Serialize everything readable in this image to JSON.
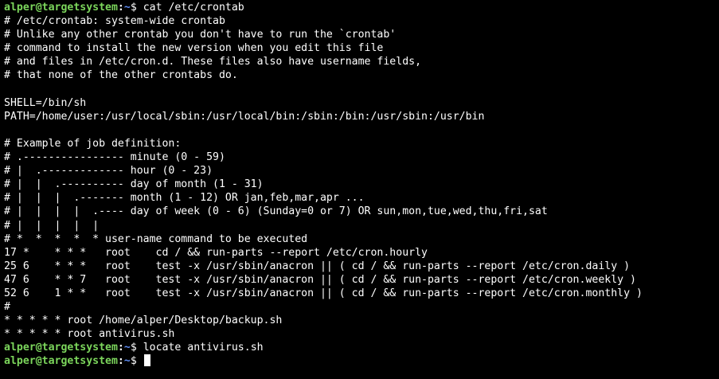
{
  "colors": {
    "background": "#000000",
    "text": "#ffffff",
    "prompt_user": "#7cd65c",
    "prompt_path": "#5f8df5"
  },
  "prompt": {
    "user_host": "alper@targetsystem",
    "colon": ":",
    "path": "~",
    "dollar": "$ "
  },
  "lines": [
    {
      "type": "prompt",
      "command": "cat /etc/crontab"
    },
    {
      "type": "text",
      "text": "# /etc/crontab: system-wide crontab"
    },
    {
      "type": "text",
      "text": "# Unlike any other crontab you don't have to run the `crontab'"
    },
    {
      "type": "text",
      "text": "# command to install the new version when you edit this file"
    },
    {
      "type": "text",
      "text": "# and files in /etc/cron.d. These files also have username fields,"
    },
    {
      "type": "text",
      "text": "# that none of the other crontabs do."
    },
    {
      "type": "text",
      "text": ""
    },
    {
      "type": "text",
      "text": "SHELL=/bin/sh"
    },
    {
      "type": "text",
      "text": "PATH=/home/user:/usr/local/sbin:/usr/local/bin:/sbin:/bin:/usr/sbin:/usr/bin"
    },
    {
      "type": "text",
      "text": ""
    },
    {
      "type": "text",
      "text": "# Example of job definition:"
    },
    {
      "type": "text",
      "text": "# .---------------- minute (0 - 59)"
    },
    {
      "type": "text",
      "text": "# |  .------------- hour (0 - 23)"
    },
    {
      "type": "text",
      "text": "# |  |  .---------- day of month (1 - 31)"
    },
    {
      "type": "text",
      "text": "# |  |  |  .------- month (1 - 12) OR jan,feb,mar,apr ..."
    },
    {
      "type": "text",
      "text": "# |  |  |  |  .---- day of week (0 - 6) (Sunday=0 or 7) OR sun,mon,tue,wed,thu,fri,sat"
    },
    {
      "type": "text",
      "text": "# |  |  |  |  |"
    },
    {
      "type": "text",
      "text": "# *  *  *  *  * user-name command to be executed"
    },
    {
      "type": "text",
      "text": "17 *    * * *   root    cd / && run-parts --report /etc/cron.hourly"
    },
    {
      "type": "text",
      "text": "25 6    * * *   root    test -x /usr/sbin/anacron || ( cd / && run-parts --report /etc/cron.daily )"
    },
    {
      "type": "text",
      "text": "47 6    * * 7   root    test -x /usr/sbin/anacron || ( cd / && run-parts --report /etc/cron.weekly )"
    },
    {
      "type": "text",
      "text": "52 6    1 * *   root    test -x /usr/sbin/anacron || ( cd / && run-parts --report /etc/cron.monthly )"
    },
    {
      "type": "text",
      "text": "#"
    },
    {
      "type": "text",
      "text": "* * * * * root /home/alper/Desktop/backup.sh"
    },
    {
      "type": "text",
      "text": "* * * * * root antivirus.sh"
    },
    {
      "type": "prompt",
      "command": "locate antivirus.sh"
    },
    {
      "type": "prompt",
      "command": "",
      "cursor": true
    }
  ]
}
